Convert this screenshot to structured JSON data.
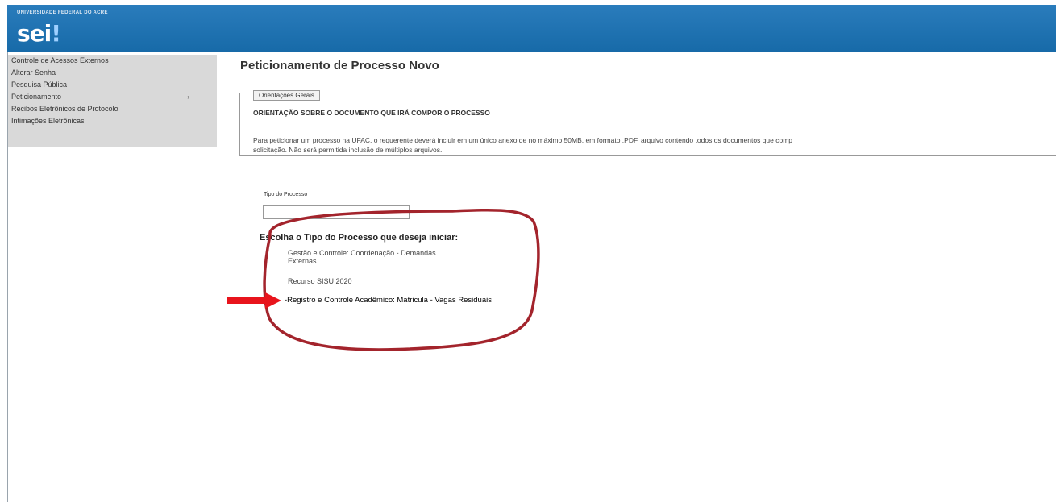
{
  "header": {
    "institution": "UNIVERSIDADE FEDERAL DO ACRE",
    "logo": "sei",
    "brand_color": "#1f6fb0"
  },
  "menu": {
    "items": [
      {
        "label": "Controle de Acessos Externos"
      },
      {
        "label": "Alterar Senha"
      },
      {
        "label": "Pesquisa Pública"
      },
      {
        "label": "Peticionamento",
        "arrow": "›"
      },
      {
        "label": "Recibos Eletrônicos de Protocolo"
      },
      {
        "label": "Intimações Eletrônicas"
      }
    ]
  },
  "main": {
    "title": "Peticionamento de Processo Novo",
    "orientacoes": {
      "legend": "Orientações Gerais",
      "heading": "ORIENTAÇÃO SOBRE O DOCUMENTO QUE IRÁ COMPOR O PROCESSO",
      "text_line1": "Para peticionar um processo na UFAC, o requerente deverá incluir em um único anexo de no máximo 50MB, em formato .PDF, arquivo contendo todos os documentos que comp",
      "text_line2": "solicitação. Não será permitida inclusão de múltiplos arquivos."
    },
    "tipo_processo": {
      "label": "Tipo do Processo",
      "value": ""
    },
    "choose_title": "Escolha o Tipo do Processo que deseja iniciar:",
    "options": [
      {
        "label": "Gestão e Controle: Coordenação - Demandas Externas"
      },
      {
        "label": "Recurso SISU 2020"
      },
      {
        "label": "-Registro e Controle Acadêmico: Matricula - Vagas Residuais"
      }
    ]
  },
  "annotation": {
    "circle_color": "#a3242c",
    "arrow_color": "#e8141c"
  }
}
